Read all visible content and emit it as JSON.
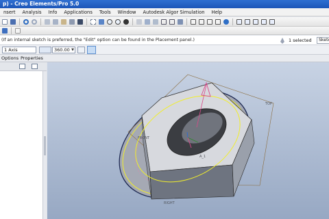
{
  "window": {
    "title": "p) - Creo Elements/Pro 5.0"
  },
  "menu": [
    "nsert",
    "Analysis",
    "Info",
    "Applications",
    "Tools",
    "Window",
    "Autodesk Algor Simulation",
    "Help"
  ],
  "message": {
    "text": "(If an internal sketch is preferred, the \"Edit\" option can be found in the Placement panel.)"
  },
  "selection": {
    "count_text": "1 selected",
    "filter_value": "Sketch"
  },
  "dashboard": {
    "axis_reference": "1 Axis",
    "angle_value": "360.00"
  },
  "tabs": [
    "Options",
    "Properties"
  ],
  "model_labels": {
    "top": "TOP",
    "left_plane": "FRONT",
    "datum": "A_1",
    "bottom": "RIGHT"
  },
  "colors": {
    "titlebar": "#1c56b8",
    "highlight_yellow": "#f1ee2a",
    "ring_navy": "#1e2a55",
    "preview_pink": "#d94a8a"
  },
  "icons": [
    "new-icon",
    "open-icon",
    "save-icon",
    "print-icon",
    "undo-icon",
    "redo-icon",
    "cut-icon",
    "copy-icon",
    "paste-icon",
    "find-icon",
    "refit-icon",
    "zoom-in-icon",
    "zoom-out-icon",
    "spin-icon",
    "saved-views-icon",
    "layers-icon",
    "datum-plane-icon",
    "datum-axis-icon",
    "datum-point-icon",
    "csys-icon",
    "help-icon"
  ]
}
